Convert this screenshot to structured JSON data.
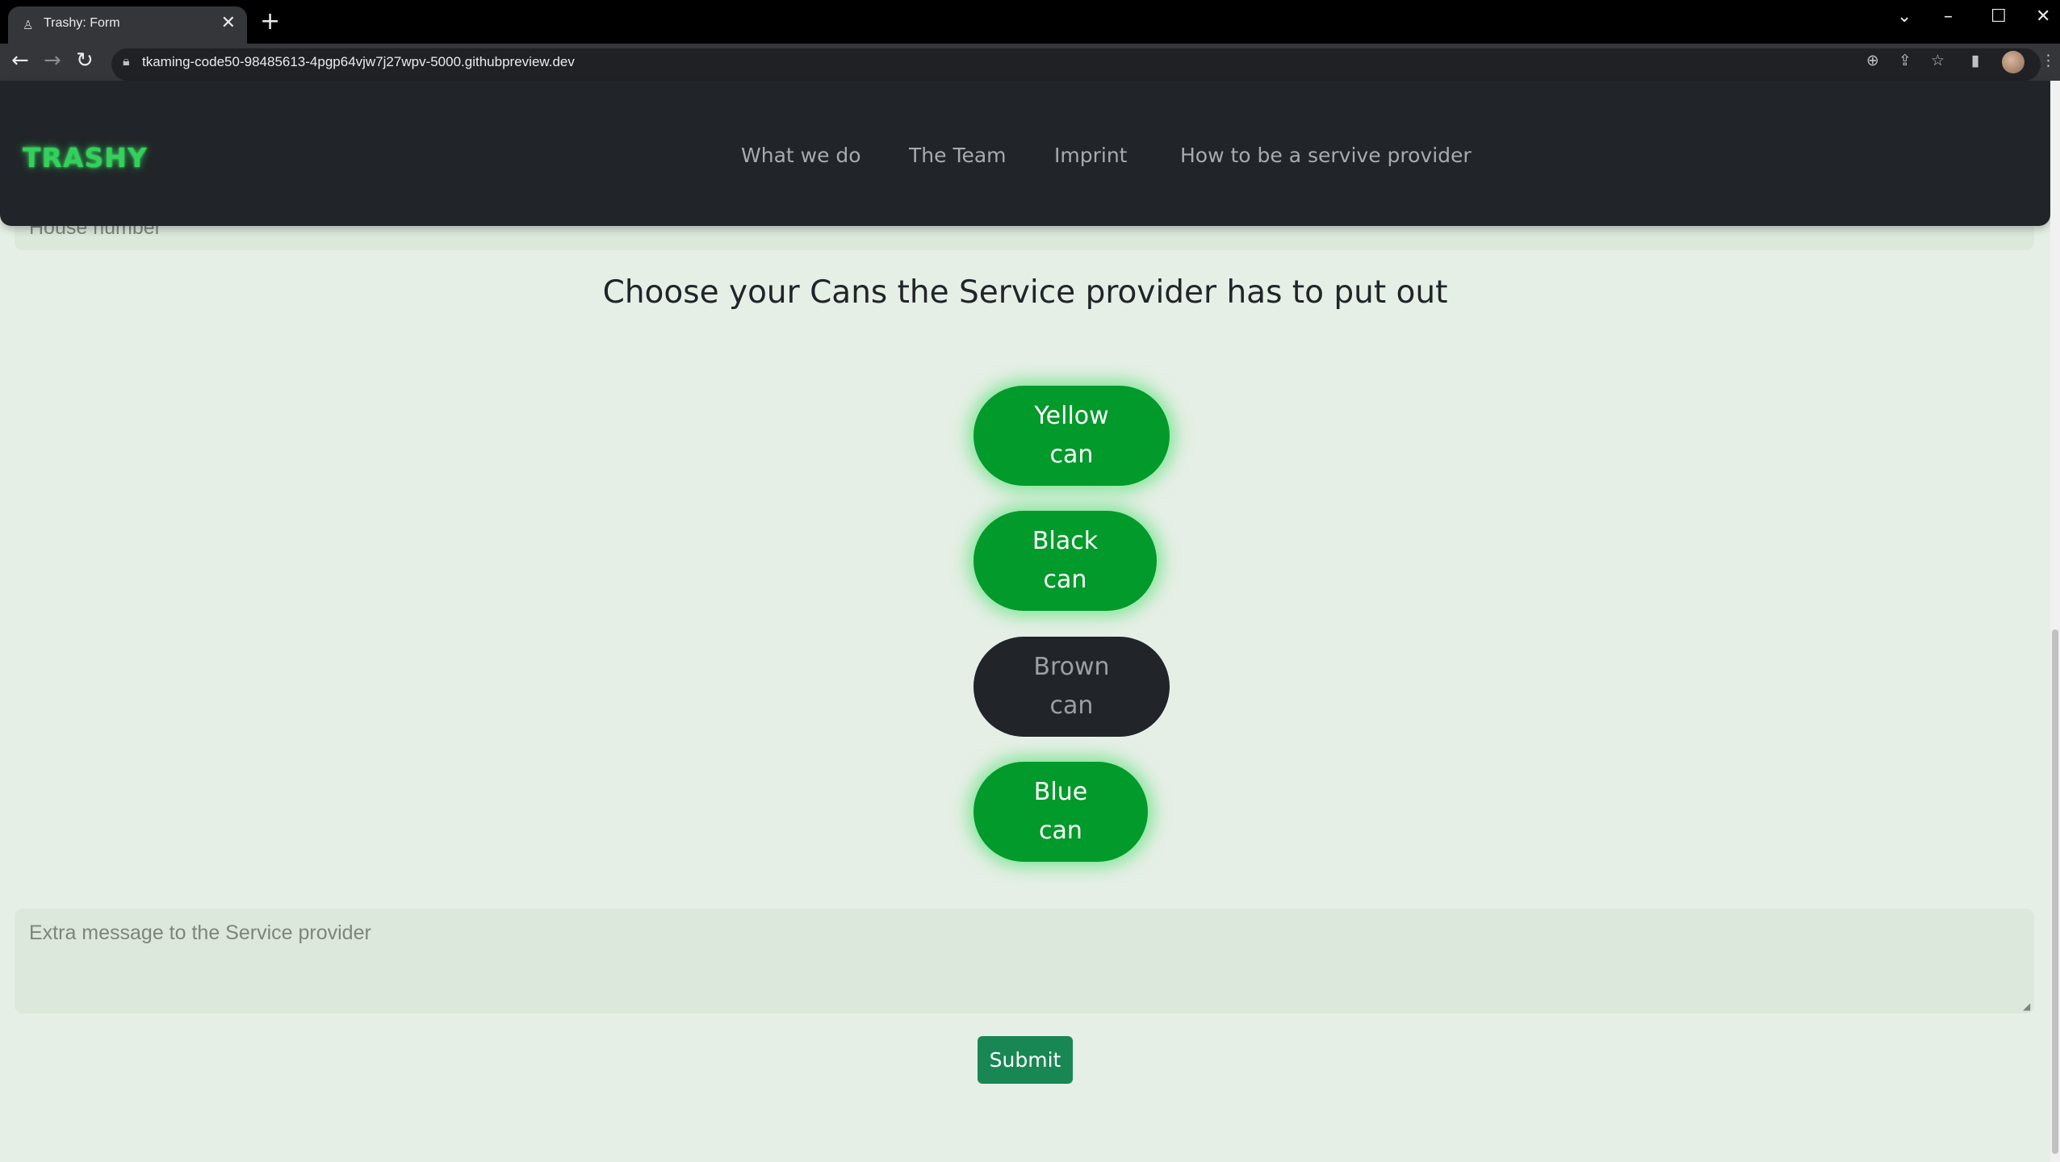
{
  "browser": {
    "tab_title": "Trashy: Form",
    "tab_close": "✕",
    "new_tab": "+",
    "url": "tkaming-code50-98485613-4pgp64vjw7j27wpv-5000.githubpreview.dev",
    "icons": [
      "back-icon",
      "forward-icon",
      "reload-icon",
      "lock-icon",
      "zoom-icon",
      "share-icon",
      "star-icon",
      "sidebar-icon",
      "avatar",
      "menu-icon"
    ]
  },
  "navbar": {
    "brand": "TRASHY",
    "links": [
      "What we do",
      "The Team",
      "Imprint",
      "How to be a servive provider"
    ]
  },
  "form": {
    "house_number_placeholder": "House number",
    "heading": "Choose your Cans the Service provider has to put out",
    "cans": [
      {
        "label": "Yellow\ncan",
        "selected": true
      },
      {
        "label": "Black\ncan",
        "selected": true
      },
      {
        "label": "Brown\ncan",
        "selected": false
      },
      {
        "label": "Blue\ncan",
        "selected": true
      }
    ],
    "message_placeholder": "Extra message to the Service provider",
    "submit_label": "Submit"
  },
  "colors": {
    "brand_green": "#33d15b",
    "selected_can": "#029a2b",
    "unselected_can": "#212529",
    "submit": "#198754",
    "page_bg": "#e6efe6"
  }
}
